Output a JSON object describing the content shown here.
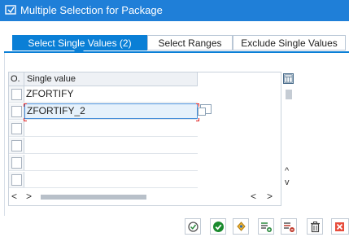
{
  "window": {
    "title": "Multiple Selection for Package"
  },
  "tabs": [
    {
      "label": "Select Single Values (2)",
      "active": true
    },
    {
      "label": "Select Ranges",
      "active": false
    },
    {
      "label": "Exclude Single Values",
      "active": false
    }
  ],
  "table": {
    "columns": [
      "O.",
      "Single value"
    ],
    "rows": [
      {
        "value": "ZFORTIFY"
      },
      {
        "value": "ZFORTIFY_2"
      },
      {
        "value": ""
      },
      {
        "value": ""
      },
      {
        "value": ""
      },
      {
        "value": ""
      }
    ]
  },
  "scroll": {
    "left_arrow": "<",
    "right_arrow": ">",
    "up_arrow": "^",
    "down_arrow": "v"
  },
  "toolbar": {
    "buttons": [
      "execute-icon",
      "confirm-icon",
      "multiple-selection-icon",
      "insert-line-icon",
      "delete-line-icon",
      "delete-all-icon"
    ]
  },
  "colors": {
    "titlebar": "#1f7fd8",
    "active_tab": "#0a7fd6",
    "confirm": "#1a8a2e"
  }
}
